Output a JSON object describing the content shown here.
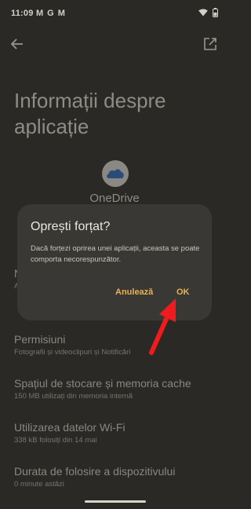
{
  "status_bar": {
    "time": "11:09",
    "notification_icons": [
      "M",
      "G",
      "M"
    ],
    "status_icons": [
      "wifi-icon",
      "battery-icon"
    ]
  },
  "toolbar": {
    "back_icon": "arrow-left-icon",
    "open_icon": "open-external-icon"
  },
  "page": {
    "title": "Informații despre aplicație",
    "app_name": "OneDrive",
    "app_icon": "onedrive-cloud-icon"
  },
  "settings": [
    {
      "title": "Permisiuni",
      "subtitle": "Fotografii și videoclipuri și Notificări"
    },
    {
      "title": "Spațiul de stocare și memoria cache",
      "subtitle": "150 MB utilizați din memoria internă"
    },
    {
      "title": "Utilizarea datelor Wi-Fi",
      "subtitle": "338 kB folosiți din 14 mai"
    },
    {
      "title": "Durata de folosire a dispozitivului",
      "subtitle": "0 minute astăzi"
    }
  ],
  "partial_item": {
    "title": "N",
    "subtitle": "A"
  },
  "dialog": {
    "title": "Oprești forțat?",
    "body": "Dacă forțezi oprirea unei aplicații, aceasta se poate comporta necorespunzător.",
    "cancel_label": "Anulează",
    "ok_label": "OK"
  },
  "colors": {
    "background": "#2a2926",
    "dialog_background": "#3a3834",
    "accent": "#e2b35a",
    "annotation_arrow": "#ee1c1c"
  }
}
